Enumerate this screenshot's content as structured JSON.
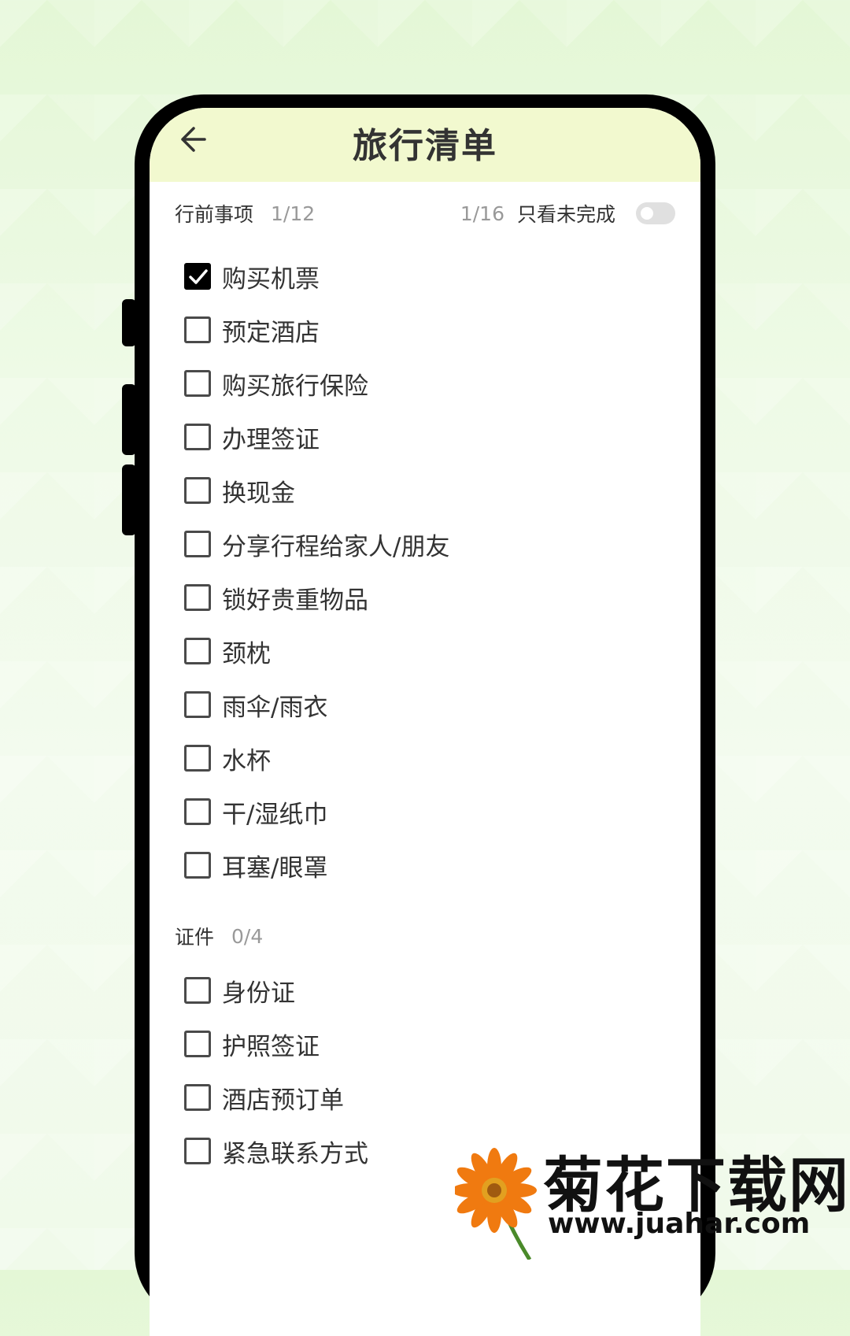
{
  "header": {
    "title": "旅行清单"
  },
  "section_before": {
    "title": "行前事项",
    "count": "1/12",
    "filter_count": "1/16",
    "filter_label": "只看未完成",
    "filter_on": false,
    "items": [
      {
        "label": "购买机票",
        "checked": true
      },
      {
        "label": "预定酒店",
        "checked": false
      },
      {
        "label": "购买旅行保险",
        "checked": false
      },
      {
        "label": "办理签证",
        "checked": false
      },
      {
        "label": "换现金",
        "checked": false
      },
      {
        "label": "分享行程给家人/朋友",
        "checked": false
      },
      {
        "label": "锁好贵重物品",
        "checked": false
      },
      {
        "label": "颈枕",
        "checked": false
      },
      {
        "label": "雨伞/雨衣",
        "checked": false
      },
      {
        "label": "水杯",
        "checked": false
      },
      {
        "label": "干/湿纸巾",
        "checked": false
      },
      {
        "label": "耳塞/眼罩",
        "checked": false
      }
    ]
  },
  "section_docs": {
    "title": "证件",
    "count": "0/4",
    "items": [
      {
        "label": "身份证",
        "checked": false
      },
      {
        "label": "护照签证",
        "checked": false
      },
      {
        "label": "酒店预订单",
        "checked": false
      },
      {
        "label": "紧急联系方式",
        "checked": false
      }
    ]
  },
  "watermark": {
    "title": "菊花下载网",
    "url": "www.juahar.com"
  },
  "colors": {
    "header_bg": "#f2f9cf",
    "checked_box": "#000000",
    "toggle_off": "#e0e0e0"
  }
}
